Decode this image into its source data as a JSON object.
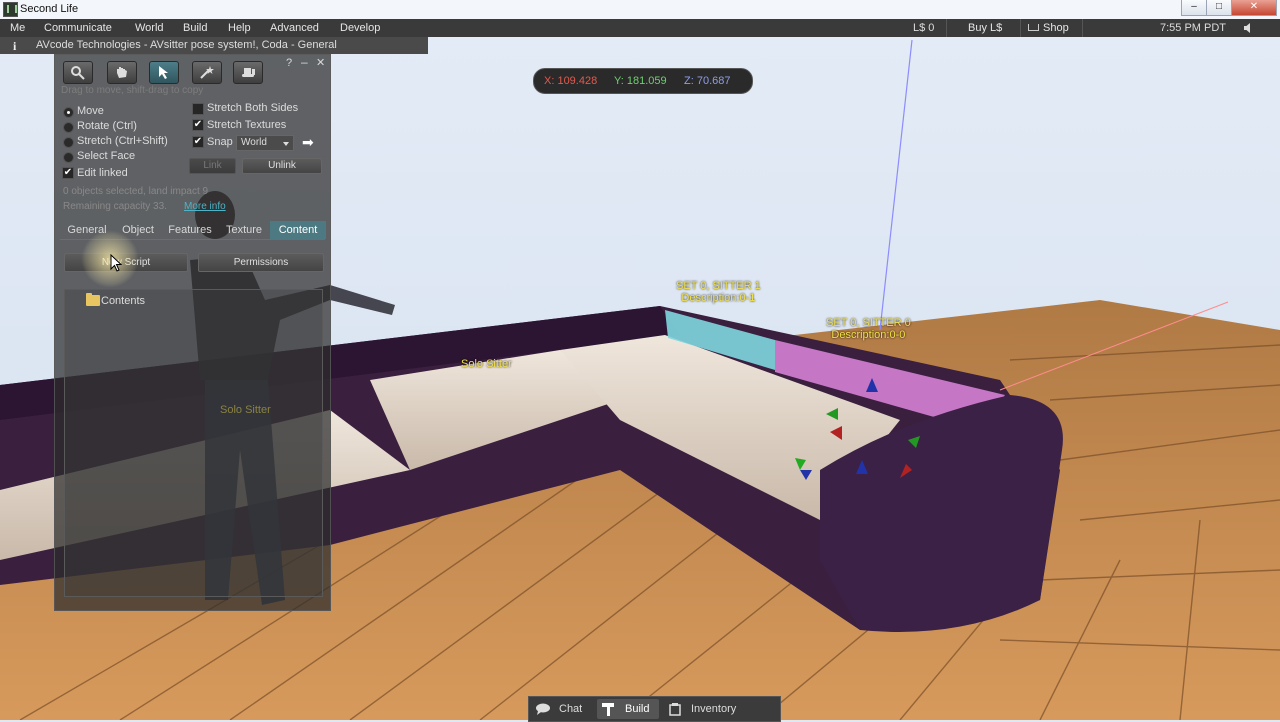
{
  "window": {
    "title": "Second Life",
    "controls": {
      "min": "–",
      "max": "□",
      "close": "✕"
    }
  },
  "menubar": {
    "items": [
      "Me",
      "Communicate",
      "World",
      "Build",
      "Help",
      "Advanced",
      "Develop"
    ],
    "balance": "L$ 0",
    "buy": "Buy L$",
    "shop": "Shop",
    "clock": "7:55 PM PDT"
  },
  "location": {
    "text": "AVcode Technologies - AVsitter pose system!, Coda - General"
  },
  "coords": {
    "x": "X: 109.428",
    "y": "Y: 181.059",
    "z": "Z: 70.687"
  },
  "build": {
    "hint": "Drag to move, shift-drag to copy",
    "help": "?",
    "minimize": "–",
    "close": "✕",
    "modes": [
      {
        "label": "Move",
        "selected": true
      },
      {
        "label": "Rotate (Ctrl)",
        "selected": false
      },
      {
        "label": "Stretch (Ctrl+Shift)",
        "selected": false
      },
      {
        "label": "Select Face",
        "selected": false
      }
    ],
    "edit_linked": "Edit linked",
    "stretch_both": "Stretch Both Sides",
    "stretch_textures": "Stretch Textures",
    "snap": "Snap",
    "snap_value": "World",
    "link": "Link",
    "unlink": "Unlink",
    "status1": "0 objects selected, land impact 9",
    "status2": "Remaining capacity 33.",
    "more_info": "More info",
    "tabs": [
      "General",
      "Object",
      "Features",
      "Texture",
      "Content"
    ],
    "active_tab": "Content",
    "new_script": "New Script",
    "permissions": "Permissions",
    "contents_folder": "Contents"
  },
  "scene_labels": {
    "sitter1_a": "SET 0, SITTER 1",
    "sitter1_b": "Description:0-1",
    "sitter0_a": "SET 0, SITTER 0",
    "sitter0_b": "Description:0-0",
    "solo": "Solo Sitter",
    "solo_ghost": "Solo Sitter"
  },
  "bottombar": {
    "chat": "Chat",
    "build": "Build",
    "inventory": "Inventory"
  }
}
